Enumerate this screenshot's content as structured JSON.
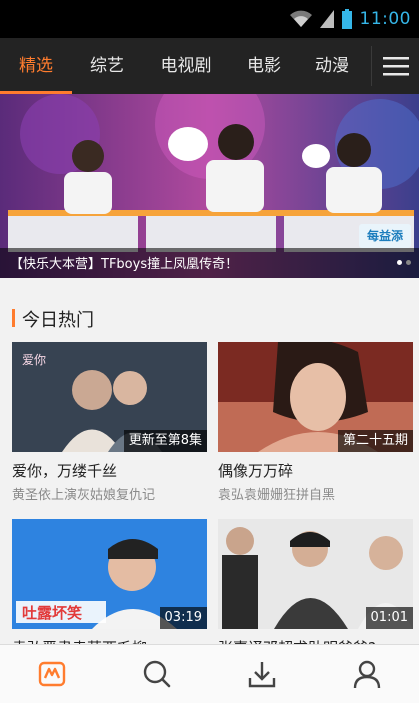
{
  "status_bar": {
    "time": "11:00",
    "icons": [
      "wifi-icon",
      "signal-icon",
      "battery-icon"
    ]
  },
  "tabs": [
    {
      "label": "精选",
      "active": true
    },
    {
      "label": "综艺",
      "active": false
    },
    {
      "label": "电视剧",
      "active": false
    },
    {
      "label": "电影",
      "active": false
    },
    {
      "label": "动漫",
      "active": false
    }
  ],
  "menu_icon": "hamburger-menu-icon",
  "banner": {
    "title": "【快乐大本营】TFboys撞上凤凰传奇！",
    "logo_text": "每益添",
    "dots": 2
  },
  "section": {
    "title": "今日热门"
  },
  "cards": [
    {
      "title": "爱你，万缕千丝",
      "subtitle": "黄圣依上演灰姑娘复仇记",
      "tag": "更新至第8集"
    },
    {
      "title": "偶像万万碎",
      "subtitle": "袁弘袁姗姗狂拼自黑",
      "tag": "第二十五期"
    },
    {
      "title": "袁弘严肃卖萌西毛柳",
      "subtitle": "",
      "tag": "03:19"
    },
    {
      "title": "张嘉译邓超求助明爸爸?",
      "subtitle": "",
      "tag": "01:01"
    }
  ],
  "bottom_nav": [
    "home-icon",
    "search-icon",
    "download-icon",
    "profile-icon"
  ],
  "colors": {
    "accent": "#ff7c2e",
    "clock": "#35b6e8",
    "tabbar": "#232323"
  }
}
